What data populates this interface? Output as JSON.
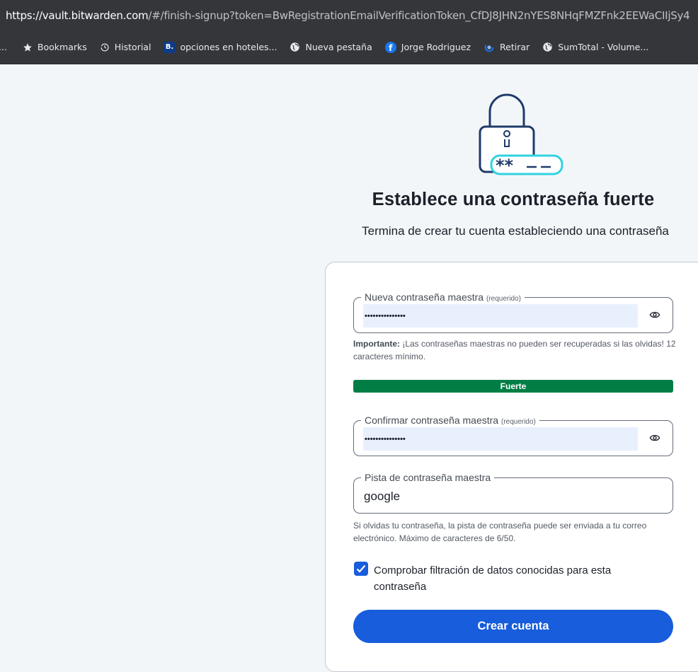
{
  "browser": {
    "url_host": "https://vault.bitwarden.com",
    "url_rest": "/#/finish-signup?token=BwRegistrationEmailVerificationToken_CfDJ8JHN2nYES8NHqFMZFnk2EEWaCIIjSy4",
    "bookmarks_overflow": "...",
    "bookmarks": [
      {
        "label": "Bookmarks",
        "icon": "star-icon"
      },
      {
        "label": "Historial",
        "icon": "history-icon"
      },
      {
        "label": "opciones en hoteles...",
        "icon": "booking-icon"
      },
      {
        "label": "Nueva pestaña",
        "icon": "globe-icon"
      },
      {
        "label": "Jorge Rodriguez",
        "icon": "facebook-icon"
      },
      {
        "label": "Retirar",
        "icon": "loading-icon"
      },
      {
        "label": "SumTotal - Volume...",
        "icon": "globe-icon"
      }
    ],
    "booking_letter": "B.",
    "facebook_letter": "f"
  },
  "page": {
    "title": "Establece una contraseña fuerte",
    "subtitle": "Termina de crear tu cuenta estableciendo una contraseña"
  },
  "form": {
    "new_password": {
      "label": "Nueva contraseña maestra",
      "required": "(requerido)",
      "value": "•••••••••••••••"
    },
    "important_label": "Importante:",
    "important_text": " ¡Las contraseñas maestras no pueden ser recuperadas si las olvidas! 12 caracteres mínimo.",
    "strength": {
      "label": "Fuerte",
      "level": 1.0
    },
    "confirm_password": {
      "label": "Confirmar contraseña maestra",
      "required": "(requerido)",
      "value": "•••••••••••••••"
    },
    "hint": {
      "label": "Pista de contraseña maestra",
      "value": "google",
      "help": "Si olvidas tu contraseña, la pista de contraseña puede ser enviada a tu correo electrónico. Máximo de caracteres de 6/50."
    },
    "breach_check": {
      "checked": true,
      "label": "Comprobar filtración de datos conocidas para esta contraseña"
    },
    "submit_label": "Crear cuenta"
  },
  "colors": {
    "primary": "#175ddc",
    "strength_strong": "#017e45",
    "autofill_bg": "#e8f0fe",
    "chrome_bg": "#35363a",
    "accent_cyan": "#2fd3e0"
  }
}
